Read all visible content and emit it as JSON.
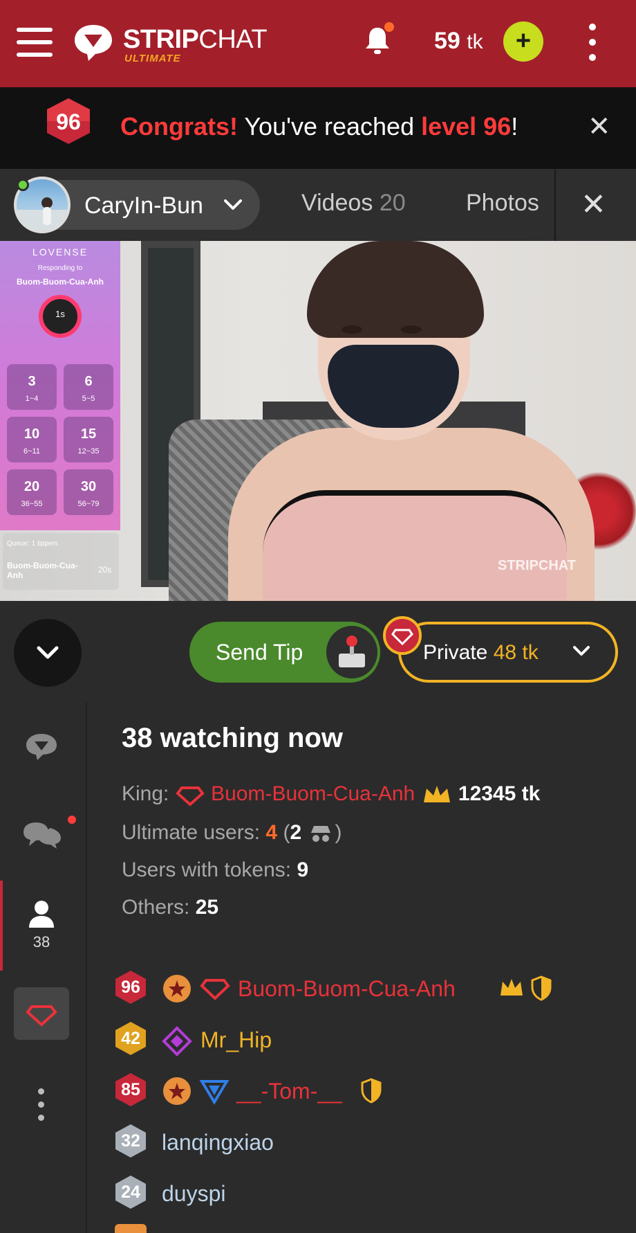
{
  "header": {
    "logo_main": "STRIP",
    "logo_chat": "CHAT",
    "logo_sub": "ULTIMATE",
    "tokens_value": "59",
    "tokens_unit": "tk",
    "add_label": "+"
  },
  "congrats": {
    "level_badge": "96",
    "congrats_word": "Congrats!",
    "middle": " You've reached ",
    "level_text": "level 96",
    "end": "!",
    "close": "✕"
  },
  "model_bar": {
    "name": "CaryIn-Bun",
    "videos_label": "Videos",
    "videos_count": "20",
    "photos_label": "Photos",
    "close": "✕"
  },
  "lovense": {
    "title": "LOVENSE",
    "responding": "Responding to",
    "user": "Buom-Buom-Cua-Anh",
    "timer": "1s",
    "levels": [
      {
        "value": "3",
        "range": "1~4"
      },
      {
        "value": "6",
        "range": "5~5"
      },
      {
        "value": "10",
        "range": "6~11"
      },
      {
        "value": "15",
        "range": "12~35"
      },
      {
        "value": "20",
        "range": "36~55"
      },
      {
        "value": "30",
        "range": "56~79"
      }
    ],
    "queue": "Queue: 1 tippers",
    "queue_user": "Buom-Buom-Cua-Anh",
    "queue_time": "20s"
  },
  "video": {
    "watermark": "STRIPCHAT"
  },
  "actions": {
    "send_tip": "Send Tip",
    "private_label": "Private",
    "private_price": "48 tk"
  },
  "sidebar": {
    "users_count": "38"
  },
  "stats": {
    "watching": "38 watching now",
    "king_label": "King:",
    "king_name": "Buom-Buom-Cua-Anh",
    "king_tokens": "12345 tk",
    "ultimate_label": "Ultimate users:",
    "ultimate_count": "4",
    "ultimate_hidden": "2",
    "tokens_label": "Users with tokens:",
    "tokens_count": "9",
    "others_label": "Others:",
    "others_count": "25"
  },
  "users": [
    {
      "level": "96",
      "name": "Buom-Buom-Cua-Anh"
    },
    {
      "level": "42",
      "name": "Mr_Hip"
    },
    {
      "level": "85",
      "name": "__-Tom-__"
    },
    {
      "level": "32",
      "name": "lanqingxiao"
    },
    {
      "level": "24",
      "name": "duyspi"
    }
  ],
  "colors": {
    "header_bg": "#a3202b",
    "accent_red": "#e8323a",
    "gold": "#f2b425",
    "green": "#4a8a2c",
    "add_button": "#c7dd1e"
  }
}
